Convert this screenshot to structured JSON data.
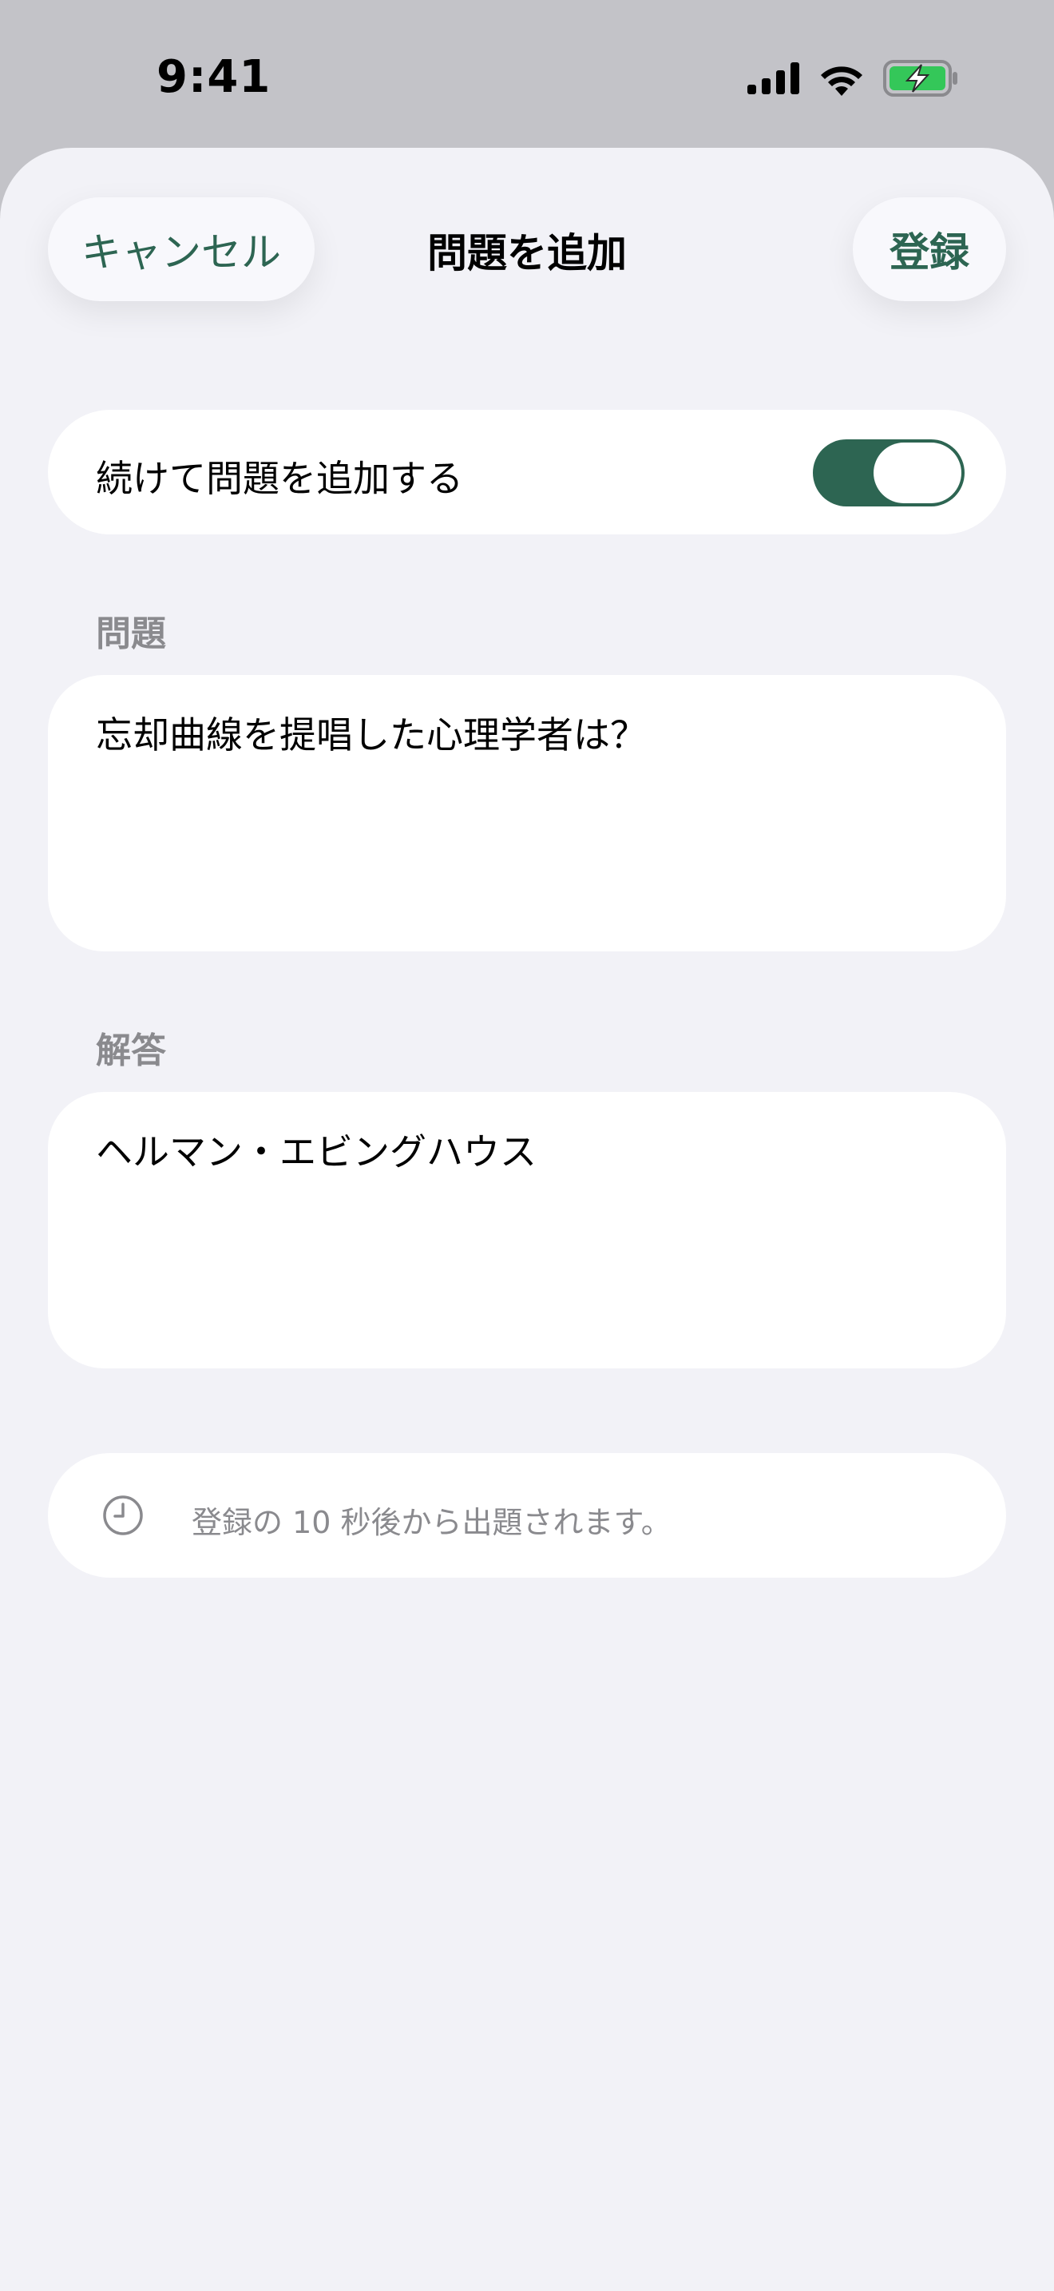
{
  "status_bar": {
    "time": "9:41"
  },
  "nav": {
    "cancel_label": "キャンセル",
    "title": "問題を追加",
    "register_label": "登録"
  },
  "continuous_add": {
    "label": "続けて問題を追加する",
    "enabled": true
  },
  "question": {
    "label": "問題",
    "value": "忘却曲線を提唱した心理学者は？"
  },
  "answer": {
    "label": "解答",
    "value": "ヘルマン・エビングハウス"
  },
  "info": {
    "icon": "clock-icon",
    "text": "登録の 10 秒後から出題されます。"
  },
  "colors": {
    "accent": "#2d6552",
    "sheet_background": "#f2f2f7",
    "secondary_text": "#8a8a8e",
    "battery_fill": "#34c759"
  }
}
